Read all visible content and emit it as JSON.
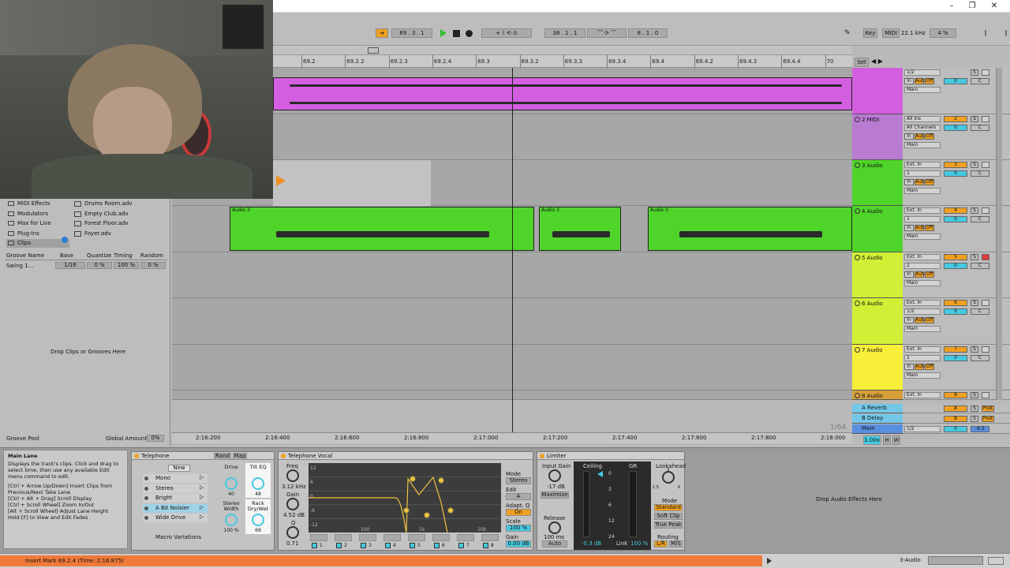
{
  "transport": {
    "follow_icon": "follow-arrow-icon",
    "arrangement_position": "69 . 3 . 1",
    "loop_start": "38 . 1 . 1",
    "loop_length": "8 . 1 . 0",
    "key_label": "Key",
    "midi_label": "MIDI",
    "sample_rate": "22.1 kHz",
    "cpu_load": "4 %"
  },
  "ruler": {
    "bars": [
      "69.2",
      "69.2.2",
      "69.2.3",
      "69.2.4",
      "69.3",
      "69.3.2",
      "69.3.3",
      "69.3.4",
      "69.4",
      "69.4.2",
      "69.4.3",
      "69.4.4",
      "70"
    ],
    "set_label": "Set"
  },
  "timeline": {
    "times": [
      "2:16:200",
      "2:16:400",
      "2:16:600",
      "2:16:800",
      "2:17:000",
      "2:17:200",
      "2:17:400",
      "2:17:600",
      "2:17:800",
      "2:18:000"
    ],
    "grid": "1/64"
  },
  "tracks": [
    {
      "name": "",
      "color": "#d45ee0",
      "input": "",
      "channel": "1/2",
      "number": "",
      "monitor": [
        "In",
        "Auto",
        "Off"
      ],
      "output": "Main",
      "vol": "0",
      "pan": "C"
    },
    {
      "name": "2 MIDI",
      "color": "#b97bd1",
      "input": "All Ins",
      "channel": "All Channels",
      "number": "2",
      "monitor": [
        "In",
        "Auto",
        "Off"
      ],
      "output": "Main",
      "vol": "0",
      "pan": "C"
    },
    {
      "name": "3 Audio",
      "color": "#4fd42a",
      "input": "Ext. In",
      "channel": "1",
      "number": "3",
      "monitor": [
        "In",
        "Auto",
        "Off"
      ],
      "output": "Main",
      "vol": "0",
      "pan": "C"
    },
    {
      "name": "4 Audio",
      "color": "#4fd42a",
      "input": "Ext. In",
      "channel": "1",
      "number": "4",
      "monitor": [
        "In",
        "Auto",
        "Off"
      ],
      "output": "Main",
      "vol": "0",
      "pan": "C"
    },
    {
      "name": "5 Audio",
      "color": "#cff035",
      "input": "Ext. In",
      "channel": "2",
      "number": "5",
      "monitor": [
        "In",
        "Auto",
        "Off"
      ],
      "output": "Main",
      "vol": "0",
      "pan": "C"
    },
    {
      "name": "6 Audio",
      "color": "#cff035",
      "input": "Ext. In",
      "channel": "1/2",
      "number": "6",
      "monitor": [
        "In",
        "Auto",
        "Off"
      ],
      "output": "Main",
      "vol": "0",
      "pan": "C"
    },
    {
      "name": "7 Audio",
      "color": "#f8ef3a",
      "input": "Ext. In",
      "channel": "1",
      "number": "7",
      "monitor": [
        "In",
        "Auto",
        "Off"
      ],
      "output": "Main",
      "vol": "0",
      "pan": "C"
    },
    {
      "name": "8 Audio",
      "color": "#d7a13a",
      "input": "Ext. In",
      "channel": "",
      "number": "8",
      "monitor": [],
      "output": "",
      "vol": "",
      "pan": ""
    }
  ],
  "returns": [
    {
      "name": "A Reverb",
      "color": "#73c7e8",
      "letter": "A",
      "post": "Post"
    },
    {
      "name": "B Delay",
      "color": "#73c7e8",
      "letter": "B",
      "post": "Post"
    }
  ],
  "main_track": {
    "name": "Main",
    "color": "#5a8ee0",
    "channel": "1/2",
    "vol": "0",
    "level": "-6.5"
  },
  "clips": {
    "label": "Audio 3",
    "zoom": "1.00x"
  },
  "browser": {
    "categories": [
      "MIDI Effects",
      "Modulators",
      "Max for Live",
      "Plug-Ins",
      "Clips"
    ],
    "files": [
      "Drums Room.adv",
      "Empty Club.adv",
      "Forest Floor.adv",
      "Foyer.adv"
    ],
    "groove_headers": [
      "Groove Name",
      "Base",
      "Quantize",
      "Timing",
      "Random"
    ],
    "groove_row": {
      "name": "Swing 1...",
      "base": "1/16",
      "quantize": "0 %",
      "timing": "100 %",
      "random": "0 %"
    },
    "drop_text": "Drop Clips or Grooves Here",
    "groove_pool": "Groove Pool",
    "global_amount_label": "Global Amount",
    "global_amount": "0%"
  },
  "info": {
    "title": "Main Lane",
    "text1": "Displays the track's clips. Click and drag to select time, then use any available Edit menu command to edit.",
    "text2": "[Ctrl + Arrow Up/Down] Insert Clips from Previous/Next Take Lane",
    "text3": "[Ctrl + Alt + Drag] Scroll Display",
    "text4": "[Ctrl + Scroll Wheel] Zoom In/Out",
    "text5": "[Alt + Scroll Wheel] Adjust Lane Height",
    "text6": "Hold [F] to View and Edit Fades"
  },
  "rack": {
    "title": "Telephone",
    "rand": "Rand",
    "map": "Map",
    "new": "New",
    "chains": [
      "Mono",
      "Stereo",
      "Bright",
      "A Bit Noisier",
      "Wide Drive"
    ],
    "macro_variations": "Macro Variations",
    "macros": [
      {
        "label": "Drive",
        "value": "40"
      },
      {
        "label": "Tilt EQ",
        "value": "48"
      },
      {
        "label": "Stereo Width",
        "value": "100 %"
      },
      {
        "label": "Rack Dry/Wet",
        "value": "69"
      }
    ]
  },
  "eq": {
    "title": "Telephone Vocal",
    "freq_label": "Freq",
    "freq": "3.12 kHz",
    "gain_label": "Gain",
    "gain": "4.52 dB",
    "q_label": "Q",
    "q": "0.71",
    "db_scale": [
      "12",
      "6",
      "0",
      "-6",
      "-12"
    ],
    "freq_scale": [
      "100",
      "1k",
      "10k"
    ],
    "bands": [
      "1",
      "2",
      "3",
      "4",
      "5",
      "6",
      "7",
      "8"
    ],
    "mode_label": "Mode",
    "mode": "Stereo",
    "edit_label": "Edit",
    "edit": "A",
    "adaptq_label": "Adapt. Q",
    "adaptq": "On",
    "scale_label": "Scale",
    "scale": "100 %",
    "out_gain_label": "Gain",
    "out_gain": "0.00 dB"
  },
  "limiter": {
    "title": "Limiter",
    "input_gain_label": "Input Gain",
    "input_gain": "-17 dB",
    "maximize": "Maximize",
    "release_label": "Release",
    "release": "100 ms",
    "auto": "Auto",
    "ceiling_label": "Ceiling",
    "ceiling": "-0.3 dB",
    "gr_label": "GR",
    "gr_scale": [
      "0",
      "3",
      "6",
      "12",
      "24"
    ],
    "link_label": "Link",
    "link": "100 %",
    "lookahead_label": "Lookahead",
    "lookahead_values": [
      "1.5",
      "3",
      "6"
    ],
    "mode_label": "Mode",
    "modes": [
      "Standard",
      "Soft Clip",
      "True Peak"
    ],
    "routing_label": "Routing",
    "routing": [
      "L/R",
      "M/S"
    ]
  },
  "drop_effects": "Drop Audio Effects Here",
  "status": {
    "message": "Insert Mark 69.2.4 (Time: 2:16:875)",
    "track": "3-Audio"
  }
}
